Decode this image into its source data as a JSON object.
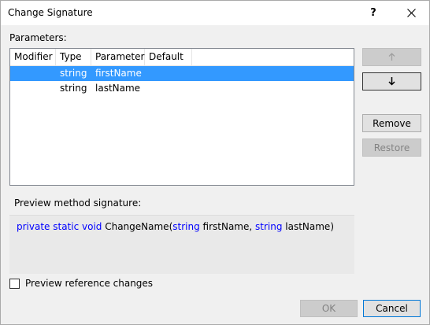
{
  "window": {
    "title": "Change Signature",
    "help_glyph": "?"
  },
  "parameters": {
    "label": "Parameters:",
    "columns": [
      "Modifier",
      "Type",
      "Parameter",
      "Default"
    ],
    "rows": [
      {
        "modifier": "",
        "type": "string",
        "parameter": "firstName",
        "default": "",
        "selected": true
      },
      {
        "modifier": "",
        "type": "string",
        "parameter": "lastName",
        "default": "",
        "selected": false
      }
    ]
  },
  "side_buttons": {
    "move_up": {
      "icon": "arrow-up-icon",
      "enabled": false
    },
    "move_down": {
      "icon": "arrow-down-icon",
      "enabled": true
    },
    "remove": {
      "label": "Remove",
      "enabled": true
    },
    "restore": {
      "label": "Restore",
      "enabled": false
    }
  },
  "preview": {
    "label": "Preview method signature:",
    "tokens": {
      "modifiers": "private static void",
      "method_name": " ChangeName(",
      "type1": "string",
      "name1": " firstName, ",
      "type2": "string",
      "name2": " lastName)"
    }
  },
  "preview_reference_changes": {
    "label": "Preview reference changes",
    "checked": false
  },
  "buttons": {
    "ok": {
      "label": "OK",
      "enabled": false
    },
    "cancel": {
      "label": "Cancel",
      "enabled": true
    }
  },
  "colors": {
    "selection": "#3399ff",
    "keyword": "#0000ff"
  }
}
